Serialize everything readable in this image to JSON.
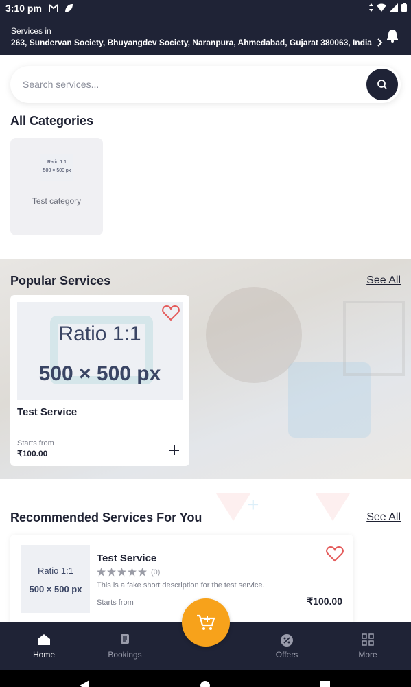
{
  "status_bar": {
    "time": "3:10 pm"
  },
  "header": {
    "services_label": "Services in",
    "address": "263, Sundervan Society, Bhuyangdev Society, Naranpura, Ahmedabad, Gujarat 380063, India"
  },
  "search": {
    "placeholder": "Search services..."
  },
  "categories": {
    "title": "All Categories",
    "items": [
      {
        "name": "Test category",
        "thumb_line1": "Ratio 1:1",
        "thumb_line2": "500 × 500 px"
      }
    ]
  },
  "popular": {
    "title": "Popular Services",
    "see_all": "See All",
    "items": [
      {
        "image_line1": "Ratio 1:1",
        "image_line2": "500 × 500 px",
        "title": "Test Service",
        "starts_label": "Starts from",
        "price": "₹100.00"
      }
    ]
  },
  "recommended": {
    "title": "Recommended Services For You",
    "see_all": "See All",
    "items": [
      {
        "image_line1": "Ratio 1:1",
        "image_line2": "500 × 500 px",
        "title": "Test Service",
        "rating_count": "(0)",
        "description": "This is a fake short description for the test service.",
        "starts_label": "Starts from",
        "price": "₹100.00"
      }
    ]
  },
  "bottom_nav": {
    "items": [
      {
        "label": "Home",
        "icon": "home-icon",
        "active": true
      },
      {
        "label": "Bookings",
        "icon": "bookings-icon",
        "active": false
      },
      {
        "label": "Offers",
        "icon": "offers-icon",
        "active": false
      },
      {
        "label": "More",
        "icon": "grid-icon",
        "active": false
      }
    ]
  },
  "colors": {
    "primary": "#1f2336",
    "accent": "#f7a21b",
    "favorite": "#e45b5b"
  }
}
